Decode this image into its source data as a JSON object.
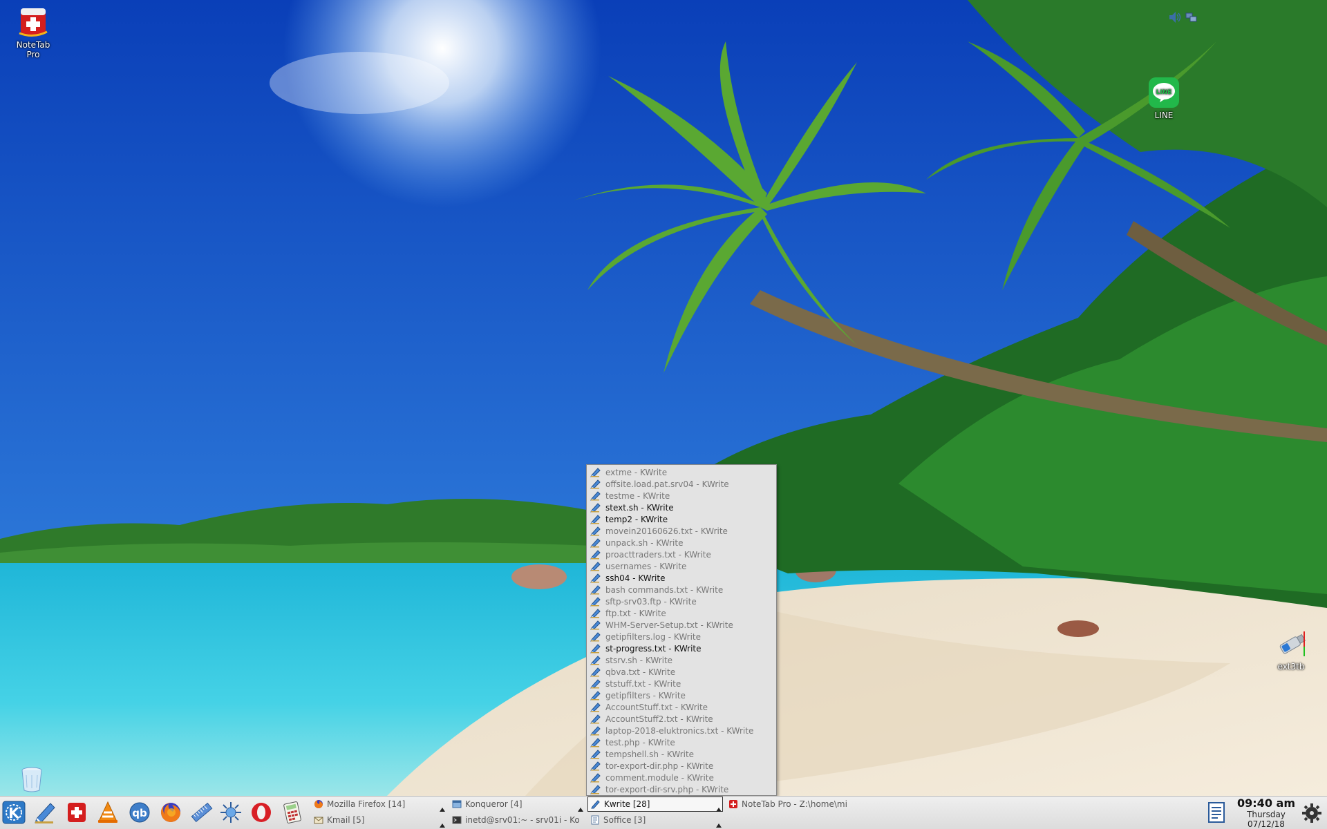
{
  "desktop": {
    "icons": [
      {
        "name": "notetab-pro",
        "label": "NoteTab\nPro"
      },
      {
        "name": "line",
        "label": "LINE"
      },
      {
        "name": "ext3tb",
        "label": "ext3tb"
      },
      {
        "name": "trash",
        "label": ""
      }
    ]
  },
  "menu": {
    "items": [
      {
        "label": "extme - KWrite",
        "active": false
      },
      {
        "label": "offsite.load.pat.srv04 - KWrite",
        "active": false
      },
      {
        "label": "testme - KWrite",
        "active": false
      },
      {
        "label": "stext.sh - KWrite",
        "active": true
      },
      {
        "label": "temp2 - KWrite",
        "active": true
      },
      {
        "label": "movein20160626.txt - KWrite",
        "active": false
      },
      {
        "label": "unpack.sh - KWrite",
        "active": false
      },
      {
        "label": "proacttraders.txt - KWrite",
        "active": false
      },
      {
        "label": "usernames - KWrite",
        "active": false
      },
      {
        "label": "ssh04 - KWrite",
        "active": true
      },
      {
        "label": "bash commands.txt - KWrite",
        "active": false
      },
      {
        "label": "sftp-srv03.ftp - KWrite",
        "active": false
      },
      {
        "label": "ftp.txt - KWrite",
        "active": false
      },
      {
        "label": "WHM-Server-Setup.txt - KWrite",
        "active": false
      },
      {
        "label": "getipfilters.log - KWrite",
        "active": false
      },
      {
        "label": "st-progress.txt - KWrite",
        "active": true
      },
      {
        "label": "stsrv.sh - KWrite",
        "active": false
      },
      {
        "label": "qbva.txt - KWrite",
        "active": false
      },
      {
        "label": "ststuff.txt - KWrite",
        "active": false
      },
      {
        "label": "getipfilters - KWrite",
        "active": false
      },
      {
        "label": "AccountStuff.txt - KWrite",
        "active": false
      },
      {
        "label": "AccountStuff2.txt - KWrite",
        "active": false
      },
      {
        "label": "laptop-2018-eluktronics.txt - KWrite",
        "active": false
      },
      {
        "label": "test.php - KWrite",
        "active": false
      },
      {
        "label": "tempshell.sh - KWrite",
        "active": false
      },
      {
        "label": "tor-export-dir.php - KWrite",
        "active": false
      },
      {
        "label": "comment.module - KWrite",
        "active": false
      },
      {
        "label": "tor-export-dir-srv.php - KWrite",
        "active": false
      }
    ]
  },
  "taskbar": {
    "launchers": [
      "kde-menu-icon",
      "kwrite-icon",
      "notetab-icon",
      "vlc-icon",
      "qbittorrent-icon",
      "firefox-icon",
      "ruler-icon",
      "network-icon",
      "opera-icon",
      "calculator-icon"
    ],
    "tasks": [
      {
        "label": "Mozilla Firefox [14]",
        "icon": "firefox-icon",
        "active": false
      },
      {
        "label": "Kmail [5]",
        "icon": "kmail-icon",
        "active": false
      },
      {
        "label": "Konqueror [4]",
        "icon": "konqueror-icon",
        "active": false
      },
      {
        "label": "inetd@srv01:~ - srv01i - Ko",
        "icon": "terminal-icon",
        "active": false
      },
      {
        "label": "Kwrite [28]",
        "icon": "kwrite-icon",
        "active": true
      },
      {
        "label": "Soffice [3]",
        "icon": "soffice-icon",
        "active": false
      },
      {
        "label": "NoteTab Pro  -  Z:\\home\\mi",
        "icon": "notetab-icon",
        "active": false
      }
    ],
    "clock": {
      "time": "09:40 am",
      "day": "Thursday",
      "date": "07/12/18"
    }
  },
  "colors": {
    "sky_top": "#0a3fb8",
    "sky_bottom": "#2f86e4",
    "sea": "#2ec4e0",
    "sand": "#efe3cf",
    "foliage": "#2e7d2e",
    "menu_bg": "#e3e3e3",
    "taskbar_bg": "#e6e6e6"
  }
}
